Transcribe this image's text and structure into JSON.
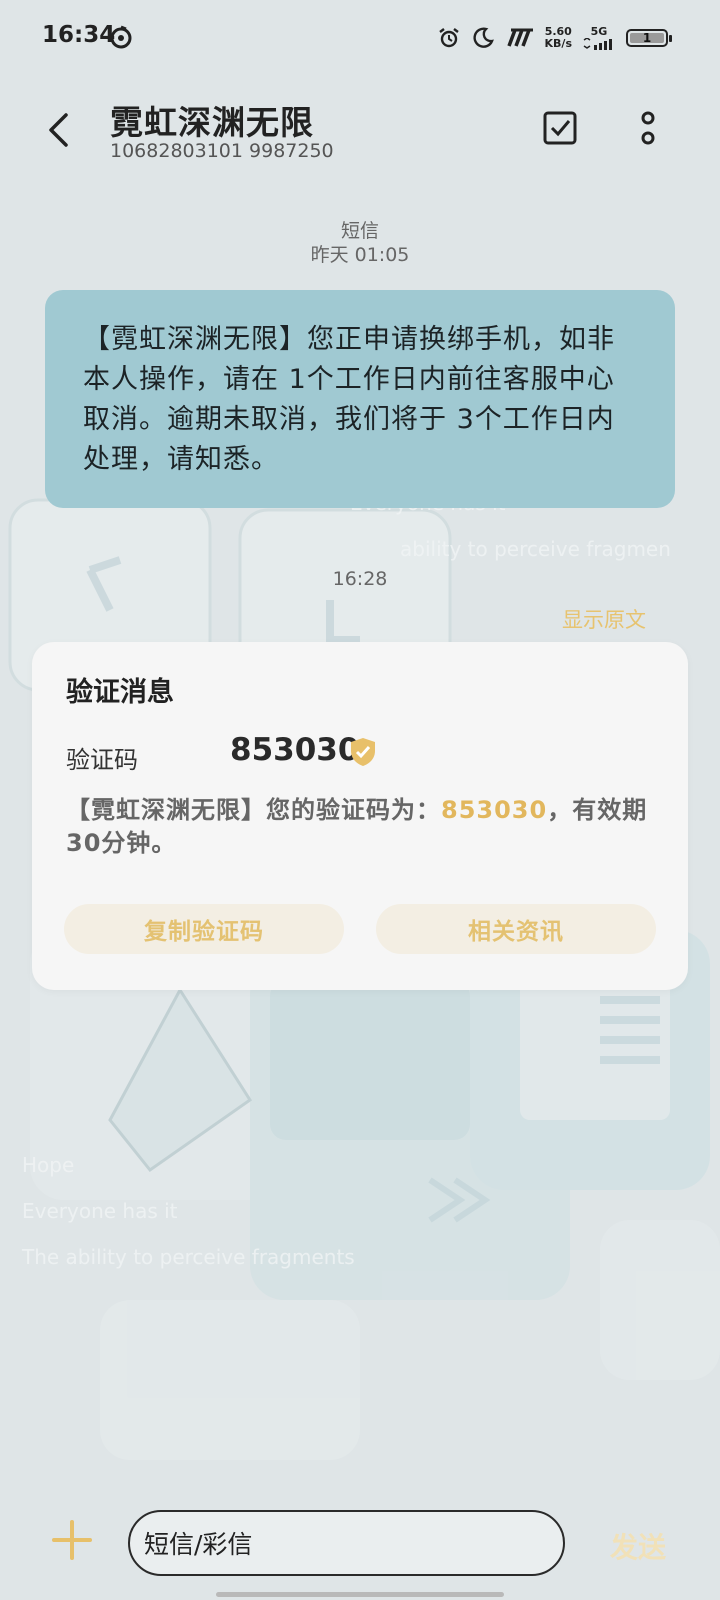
{
  "status": {
    "time": "16:34",
    "net_speed_value": "5.60",
    "net_speed_unit": "KB/s",
    "network": "5G",
    "battery": "1"
  },
  "header": {
    "name": "霓虹深渊无限",
    "number": "10682803101 9987250"
  },
  "thread": {
    "label1": "短信",
    "time1": "昨天 01:05",
    "message1": "【霓虹深渊无限】您正申请换绑手机，如非本人操作，请在 1个工作日内前往客服中心取消。逾期未取消，我们将于 3个工作日内处理，请知悉。",
    "time2": "16:28",
    "show_original": "显示原文"
  },
  "card": {
    "title": "验证消息",
    "code_label": "验证码",
    "code": "853030",
    "message_prefix": "【霓虹深渊无限】您的验证码为：",
    "message_code": "853030",
    "message_suffix": "，有效期30分钟。",
    "copy_button": "复制验证码",
    "related_button": "相关资讯"
  },
  "composer": {
    "placeholder": "短信/彩信",
    "send": "发送"
  },
  "colors": {
    "bubble": "#a0c9d2",
    "accent_gold": "#e4c272",
    "background": "#dfe5e7"
  },
  "background_text": [
    "Everyone has it",
    "ability to perceive fragmen",
    "Hope",
    "Everyone has it",
    "The ability to perceive fragments"
  ]
}
